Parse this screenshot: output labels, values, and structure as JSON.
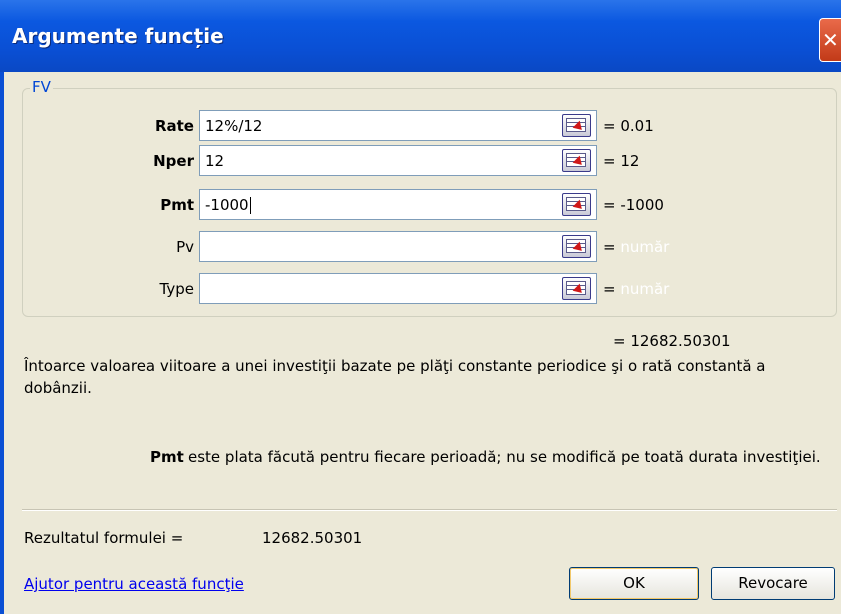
{
  "window": {
    "title": "Argumente funcție"
  },
  "function_group": {
    "name": "FV",
    "arguments": [
      {
        "label": "Rate",
        "bold": true,
        "value": "12%/12",
        "evaluated": "= 0.01"
      },
      {
        "label": "Nper",
        "bold": true,
        "value": "12",
        "evaluated": "= 12"
      },
      {
        "label": "Pmt",
        "bold": true,
        "value": "-1000",
        "evaluated": "= -1000"
      },
      {
        "label": "Pv",
        "bold": false,
        "value": "",
        "evaluated": "=",
        "hint": "număr"
      },
      {
        "label": "Type",
        "bold": false,
        "value": "",
        "evaluated": "=",
        "hint": "număr"
      }
    ]
  },
  "result_line": "= 12682.50301",
  "description": "Întoarce valoarea viitoare a unei investiţii bazate pe plăţi constante periodice şi o rată constantă a dobânzii.",
  "current_argument": {
    "name": "Pmt",
    "text": "este plata făcută pentru fiecare perioadă; nu se modifică pe toată durata investiţiei."
  },
  "formula_result": {
    "label": "Rezultatul formulei =",
    "value": "12682.50301"
  },
  "help_link": "Ajutor pentru această funcţie",
  "buttons": {
    "ok": "OK",
    "cancel": "Revocare"
  },
  "colors": {
    "title_bar": "#0a4fd4",
    "dialog_bg": "#ece9d8",
    "link": "#0000ee",
    "group_legend": "#0046d5"
  },
  "icons": {
    "close": "close-icon",
    "ref": "range-reference-icon"
  }
}
